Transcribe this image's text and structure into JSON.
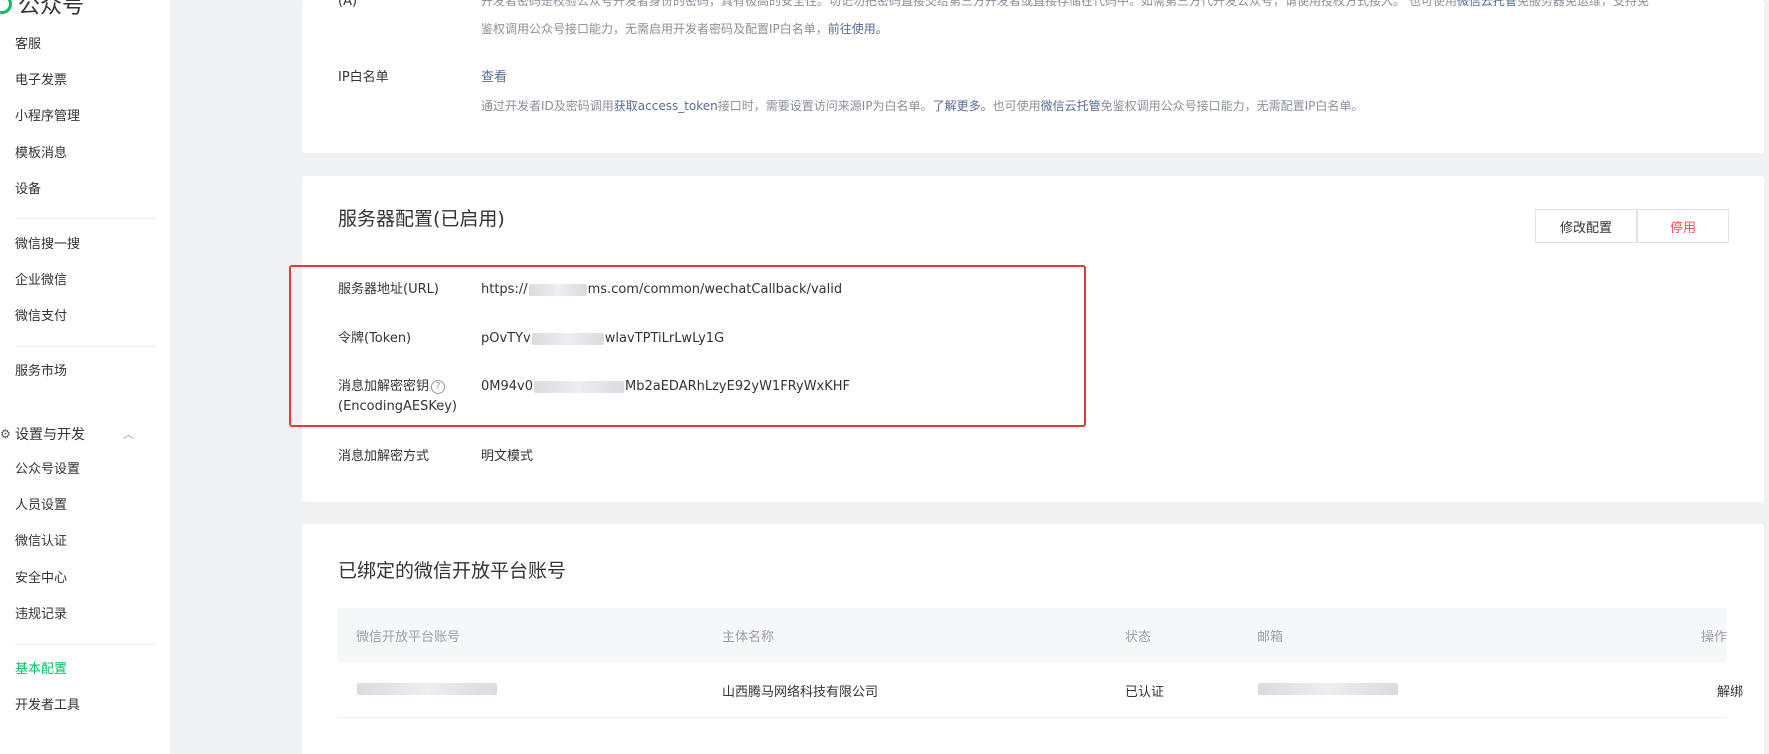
{
  "brand": {
    "name": "公众号"
  },
  "sidebar": {
    "items_a": [
      "客服",
      "电子发票",
      "小程序管理",
      "模板消息",
      "设备"
    ],
    "items_b": [
      "微信搜一搜",
      "企业微信",
      "微信支付"
    ],
    "items_c": [
      "服务市场"
    ],
    "group": {
      "label": "设置与开发",
      "icon": "gear-icon",
      "chevron": "chevron-up-icon"
    },
    "items_d": [
      "公众号设置",
      "人员设置",
      "微信认证",
      "安全中心",
      "违规记录"
    ],
    "items_e": [
      "基本配置",
      "开发者工具"
    ],
    "active_item": "基本配置"
  },
  "top_card": {
    "secret_desc_line1": "开发者密码是校验公众号开发者身份的密码，具有极高的安全性。切记勿把密码直接交给第三方开发者或直接存储在代码中。如需第三方代开发公众号，请使用授权方式接入。 也可使用",
    "secret_desc_link1": "微信云托管",
    "secret_desc_line1_tail": "免服务器免运维，支持免",
    "secret_desc_line2": "鉴权调用公众号接口能力，无需启用开发者密码及配置IP白名单，",
    "secret_desc_link2": "前往使用。",
    "ip_label": "IP白名单",
    "ip_view_link": "查看",
    "ip_desc_1": "通过开发者ID及密码调用",
    "ip_desc_link1": "获取access_token",
    "ip_desc_2": "接口时，需要设置访问来源IP为白名单。",
    "ip_desc_link2": "了解更多。",
    "ip_desc_3": "也可使用",
    "ip_desc_link3": "微信云托管",
    "ip_desc_4": "免鉴权调用公众号接口能力，无需配置IP白名单。"
  },
  "server_config": {
    "title": "服务器配置(已启用)",
    "modify_button": "修改配置",
    "disable_button": "停用",
    "url_label": "服务器地址(URL)",
    "url_value_prefix": "https://",
    "url_value_suffix": "ms.com/common/wechatCallback/valid",
    "token_label": "令牌(Token)",
    "token_value_prefix": "pOvTYv",
    "token_value_suffix": "wlavTPTiLrLwLy1G",
    "aes_label_line1": "消息加解密密钥",
    "aes_label_line2": "(EncodingAESKey)",
    "aes_help": "?",
    "aes_value_prefix": "0M94v0",
    "aes_value_suffix": "Mb2aEDARhLzyE92yW1FRyWxKHF",
    "mode_label": "消息加解密方式",
    "mode_value": "明文模式"
  },
  "bound": {
    "title": "已绑定的微信开放平台账号",
    "columns": [
      "微信开放平台账号",
      "主体名称",
      "状态",
      "邮箱",
      "操作"
    ],
    "rows": [
      {
        "entity": "山西腾马网络科技有限公司",
        "status": "已认证",
        "action": "解绑"
      }
    ]
  }
}
